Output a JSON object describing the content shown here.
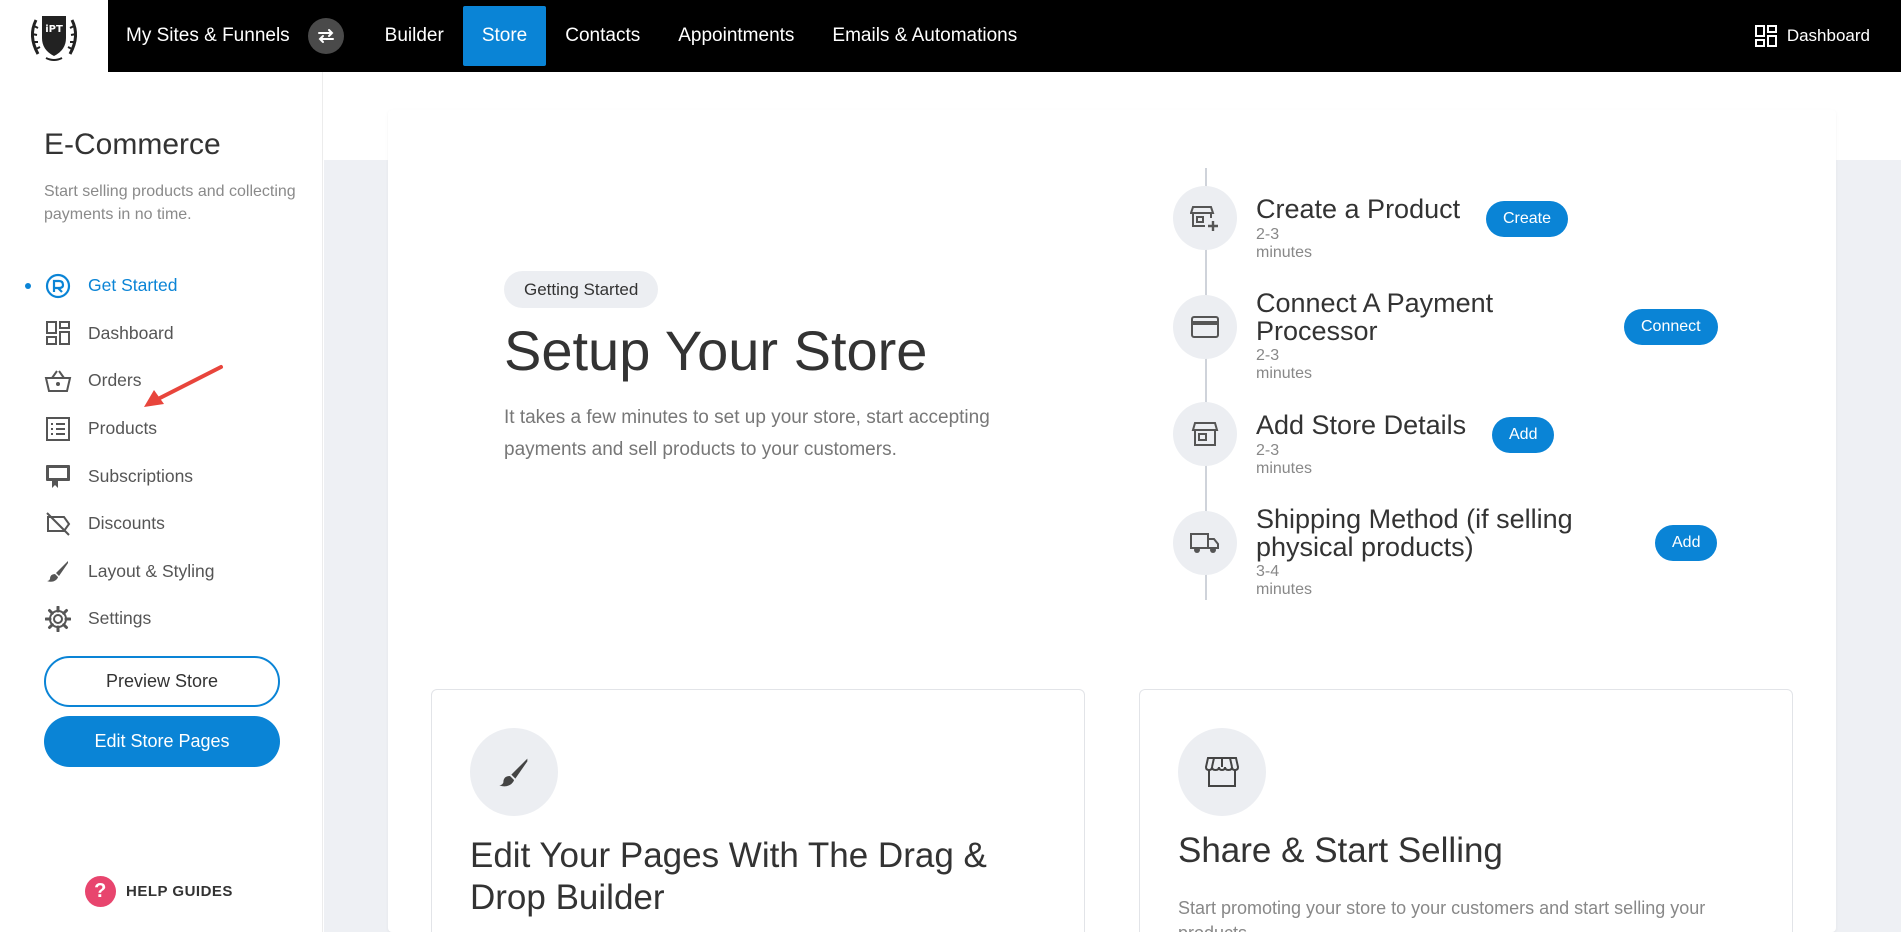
{
  "topnav": {
    "sites_label": "My Sites & Funnels",
    "links": [
      "Builder",
      "Store",
      "Contacts",
      "Appointments",
      "Emails & Automations"
    ],
    "active_link": "Store",
    "dashboard_label": "Dashboard",
    "accent": "#0a84d6"
  },
  "sidebar": {
    "title": "E-Commerce",
    "subtitle": "Start selling products and collecting payments in no time.",
    "items": [
      {
        "label": "Get Started",
        "icon": "rocket-icon",
        "active": true
      },
      {
        "label": "Dashboard",
        "icon": "dashboard-icon"
      },
      {
        "label": "Orders",
        "icon": "basket-icon"
      },
      {
        "label": "Products",
        "icon": "list-icon"
      },
      {
        "label": "Subscriptions",
        "icon": "subscriptions-icon"
      },
      {
        "label": "Discounts",
        "icon": "discount-icon"
      },
      {
        "label": "Layout & Styling",
        "icon": "brush-icon"
      },
      {
        "label": "Settings",
        "icon": "gear-icon"
      }
    ],
    "preview_label": "Preview Store",
    "edit_label": "Edit Store Pages",
    "help_label": "HELP GUIDES"
  },
  "hero": {
    "chip": "Getting Started",
    "title": "Setup Your Store",
    "description": "It takes a few minutes to set up your store, start accepting payments and sell products to your customers."
  },
  "steps": [
    {
      "title": "Create a Product",
      "duration": "2-3 minutes",
      "button": "Create",
      "icon": "add-product-icon"
    },
    {
      "title": "Connect A Payment Processor",
      "duration": "2-3 minutes",
      "button": "Connect",
      "icon": "credit-card-icon"
    },
    {
      "title": "Add Store Details",
      "duration": "2-3 minutes",
      "button": "Add",
      "icon": "store-icon"
    },
    {
      "title": "Shipping Method (if selling physical products)",
      "duration": "3-4 minutes",
      "button": "Add",
      "icon": "truck-icon"
    }
  ],
  "cards": [
    {
      "title": "Edit Your Pages With The Drag & Drop Builder",
      "description": "",
      "icon": "brush-icon"
    },
    {
      "title": "Share & Start Selling",
      "description": "Start promoting your store to your customers and start selling your products.",
      "icon": "storefront-icon"
    }
  ]
}
